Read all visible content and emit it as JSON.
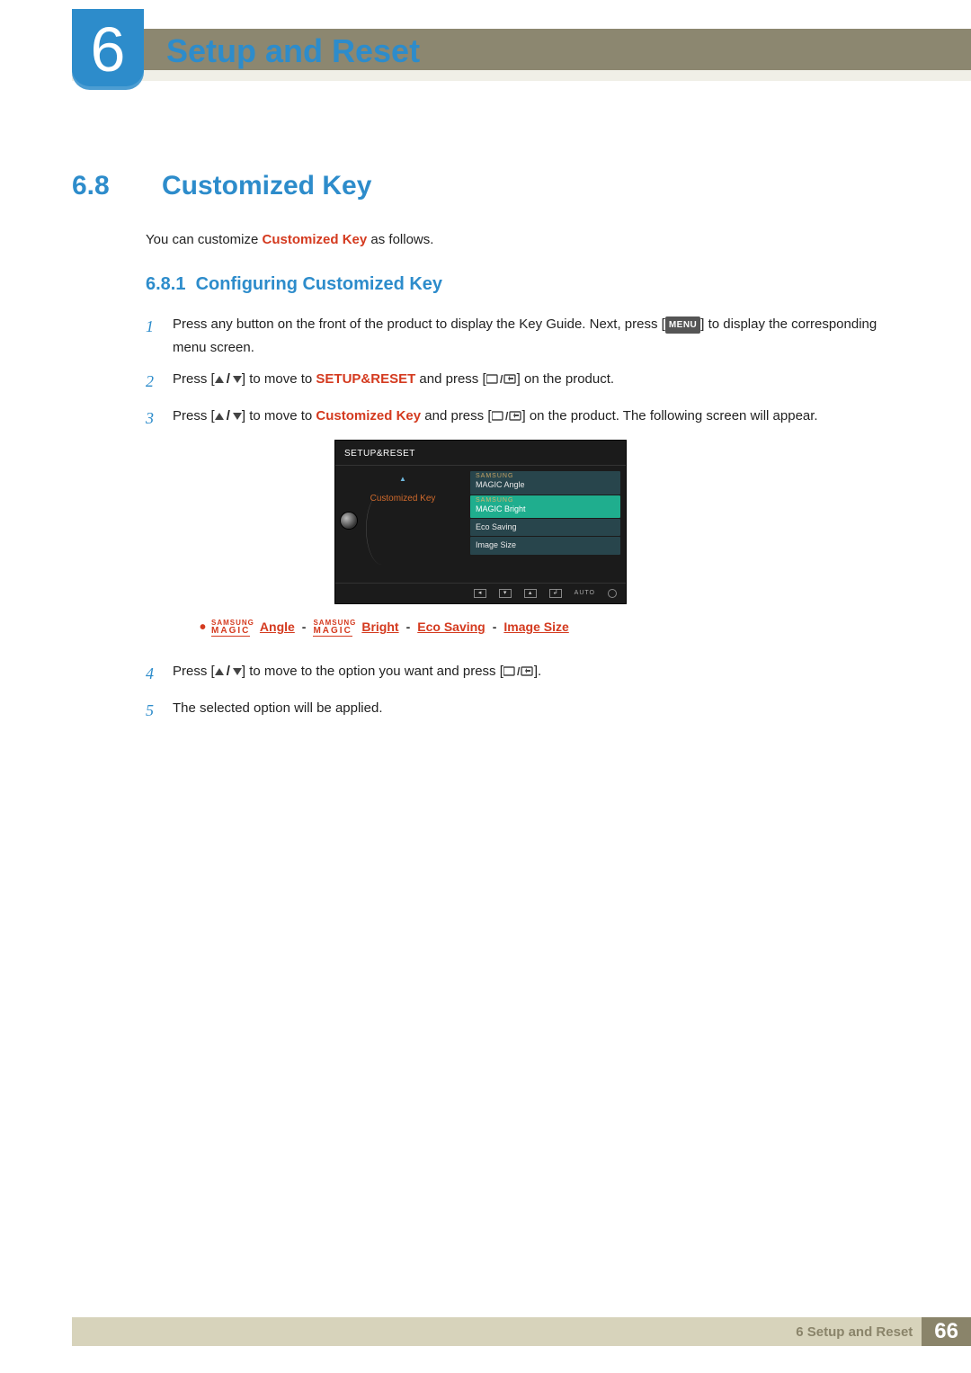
{
  "chapter": {
    "number": "6",
    "title": "Setup and Reset"
  },
  "section": {
    "number": "6.8",
    "title": "Customized Key"
  },
  "intro": {
    "pre": "You can customize ",
    "highlight": "Customized Key",
    "post": " as follows."
  },
  "subsection": {
    "number": "6.8.1",
    "title": "Configuring Customized Key"
  },
  "steps": {
    "s1": {
      "num": "1",
      "a": "Press any button on the front of the product to display the Key Guide. Next, press [",
      "menu": "MENU",
      "b": "] to display the corresponding menu screen."
    },
    "s2": {
      "num": "2",
      "a": "Press [",
      "b": "] to move to ",
      "hl": "SETUP&RESET",
      "c": " and press [",
      "d": "] on the product."
    },
    "s3": {
      "num": "3",
      "a": "Press [",
      "b": "] to move to ",
      "hl": "Customized Key",
      "c": " and press [",
      "d": "] on the product. The following screen will appear."
    },
    "s4": {
      "num": "4",
      "a": "Press [",
      "b": "] to move to the option you want and press [",
      "c": "]."
    },
    "s5": {
      "num": "5",
      "text": "The selected option will be applied."
    }
  },
  "magic_line": {
    "samsung": "SAMSUNG",
    "magic": "MAGIC",
    "angle": "Angle",
    "bright": "Bright",
    "eco": "Eco Saving",
    "image": "Image Size"
  },
  "osd": {
    "header": "SETUP&RESET",
    "left_item": "Customized Key",
    "options": [
      {
        "top": "SAMSUNG",
        "mid": "MAGIC",
        "suffix": " Angle"
      },
      {
        "top": "SAMSUNG",
        "mid": "MAGIC",
        "suffix": " Bright"
      },
      {
        "label": "Eco Saving"
      },
      {
        "label": "Image Size"
      }
    ],
    "footer": {
      "auto": "AUTO"
    }
  },
  "footer": {
    "text": "6 Setup and Reset",
    "page": "66"
  }
}
